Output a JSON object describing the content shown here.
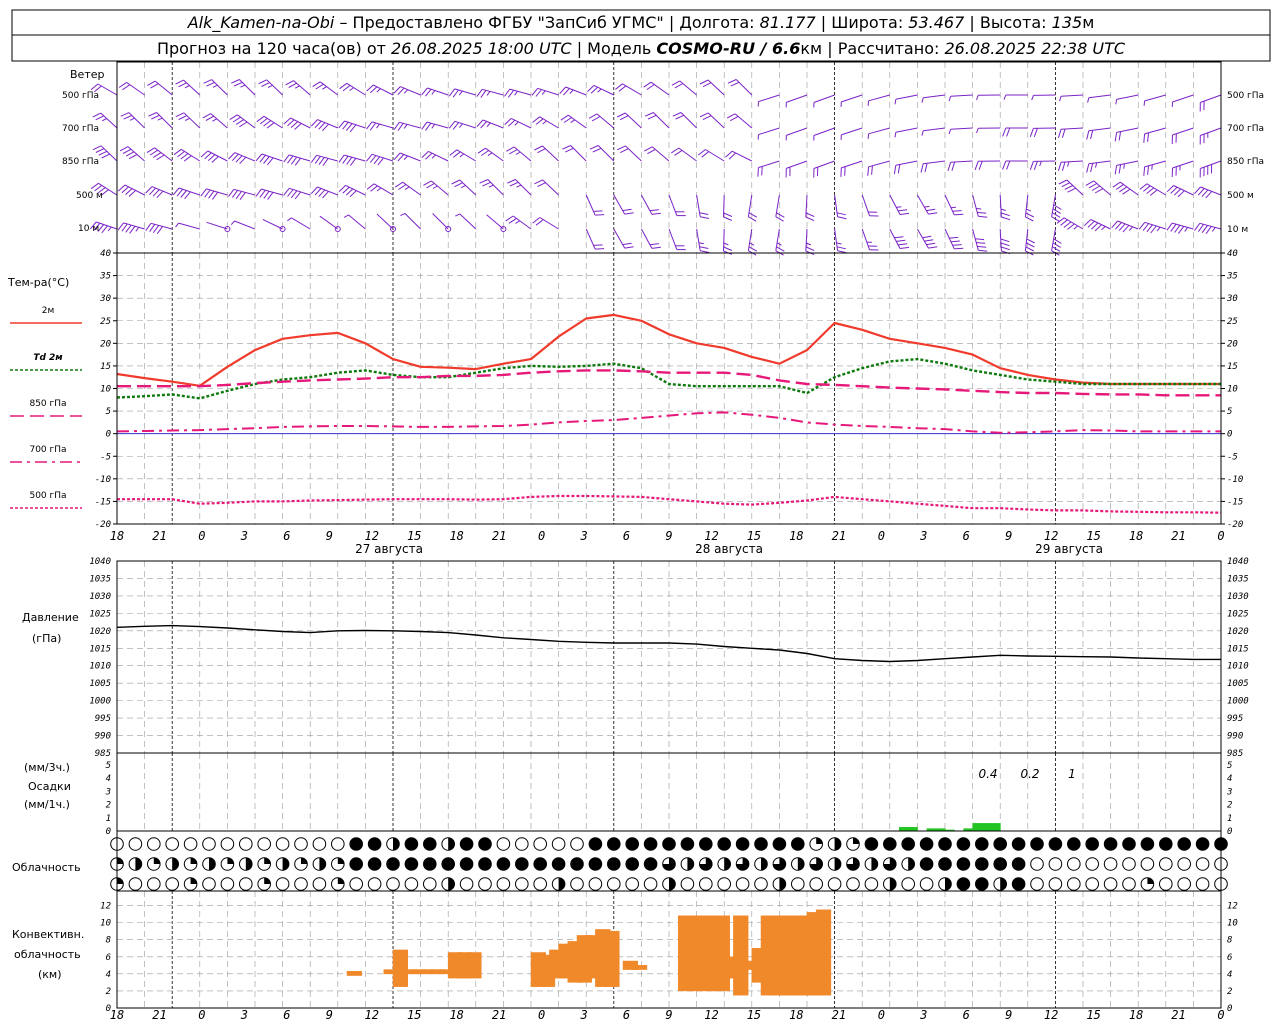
{
  "header": {
    "station": "Alk_Kamen-na-Obi",
    "dash": "–",
    "provider": "Предоставлено ФГБУ \"ЗапСиб УГМС\"",
    "lon_label": "Долгота:",
    "lon": "81.177",
    "lat_label": "Широта:",
    "lat": "53.467",
    "alt_label": "Высота:",
    "alt": "135",
    "alt_unit": "м",
    "forecast_label": "Прогноз на 120 часа(ов) от",
    "forecast_from": "26.08.2025 18:00 UTC",
    "model_label": "Модель",
    "model": "COSMO-RU / 6.6",
    "model_unit": "км",
    "calc_label": "Рассчитано:",
    "calc": "26.08.2025 22:38 UTC"
  },
  "labels": {
    "wind": "Ветер",
    "wind_levels": [
      "500 гПа",
      "700 гПа",
      "850 гПа",
      "500 м",
      "10  м"
    ],
    "temp": "Тем-ра(°С)",
    "legend": [
      "2м",
      "Td  2м",
      "850 гПа",
      "700 гПа",
      "500 гПа"
    ],
    "pressure": [
      "Давление",
      "(гПа)"
    ],
    "precip": [
      "(мм/3ч.)",
      "Осадки",
      "(мм/1ч.)"
    ],
    "cloud": "Облачность",
    "conv": [
      "Конвективн.",
      "облачность",
      "(км)"
    ]
  },
  "dates": [
    "27 августа",
    "28 августа",
    "29 августа"
  ],
  "precip_values": [
    "0.4",
    "0.2",
    "1"
  ],
  "colors": {
    "t2m": "#f03a2c",
    "td2m": "#0e7a0e",
    "magenta": "#e6187a",
    "wind": "#7b22c8",
    "precip": "#22c522",
    "conv": "#f0892a",
    "zero_line": "#3333cc"
  },
  "chart_data": [
    {
      "type": "wind-barbs",
      "title": "Ветер",
      "levels": [
        "500 гПа",
        "700 гПа",
        "850 гПа",
        "500 м",
        "10 м"
      ],
      "x_hours_from_start": [
        0,
        12,
        24,
        36,
        48,
        60,
        72,
        84,
        96,
        108,
        120
      ],
      "x_tick_labels": [
        "18",
        "21",
        "0",
        "3",
        "6",
        "9",
        "12",
        "15",
        "18",
        "21",
        "0",
        "3",
        "6",
        "9",
        "12",
        "15",
        "18",
        "21",
        "0",
        "3",
        "6",
        "9",
        "12",
        "15",
        "18",
        "21",
        "0"
      ]
    },
    {
      "type": "line",
      "title": "Тем-ра(°С)",
      "ylim": [
        -20,
        40
      ],
      "yticks": [
        -20,
        -15,
        -10,
        -5,
        0,
        5,
        10,
        15,
        20,
        25,
        30,
        35,
        40
      ],
      "x_tick_labels": [
        "18",
        "21",
        "0",
        "3",
        "6",
        "9",
        "12",
        "15",
        "18",
        "21",
        "0",
        "3",
        "6",
        "9",
        "12",
        "15",
        "18",
        "21",
        "0",
        "3",
        "6",
        "9",
        "12",
        "15",
        "18",
        "21",
        "0"
      ],
      "x_hours_from_start": [
        0,
        3,
        6,
        9,
        12,
        15,
        18,
        21,
        24,
        27,
        30,
        33,
        36,
        39,
        42,
        45,
        48,
        51,
        54,
        57,
        60,
        63,
        66,
        69,
        72,
        75,
        78,
        81,
        84,
        87,
        90,
        93,
        96,
        99,
        102,
        105,
        108,
        111,
        114,
        117,
        120
      ],
      "series": [
        {
          "name": "2м",
          "values": [
            13.2,
            12.3,
            11.5,
            10.6,
            14.8,
            18.5,
            21.0,
            21.8,
            22.3,
            20.0,
            16.5,
            14.8,
            14.6,
            14.3,
            15.5,
            16.5,
            21.5,
            25.5,
            26.3,
            25.0,
            22.0,
            20.0,
            19.0,
            17.0,
            15.5,
            18.5,
            24.5,
            23.0,
            21.0,
            20.0,
            19.0,
            17.5,
            14.5,
            13.0,
            12.0,
            11.3,
            11.0,
            11.0,
            11.0,
            11.0,
            11.0
          ]
        },
        {
          "name": "Td  2м",
          "values": [
            8.0,
            8.3,
            8.7,
            7.8,
            9.5,
            11.0,
            12.0,
            12.5,
            13.5,
            14.0,
            13.0,
            12.5,
            12.5,
            13.5,
            14.5,
            15.0,
            14.8,
            15.0,
            15.5,
            14.5,
            11.0,
            10.5,
            10.5,
            10.5,
            10.5,
            9.0,
            12.5,
            14.5,
            16.0,
            16.5,
            15.5,
            14.0,
            13.0,
            12.0,
            11.5,
            11.0,
            11.0,
            11.0,
            11.0,
            11.0,
            11.0
          ]
        },
        {
          "name": "850 гПа",
          "values": [
            10.5,
            10.5,
            10.5,
            10.5,
            10.8,
            11.2,
            11.5,
            11.8,
            12.0,
            12.2,
            12.5,
            12.5,
            12.8,
            12.8,
            13.0,
            13.5,
            13.8,
            14.0,
            14.0,
            13.8,
            13.5,
            13.5,
            13.5,
            13.0,
            11.8,
            11.0,
            10.8,
            10.5,
            10.2,
            10.0,
            9.8,
            9.5,
            9.2,
            9.0,
            9.0,
            8.8,
            8.7,
            8.7,
            8.5,
            8.5,
            8.5
          ]
        },
        {
          "name": "700 гПа",
          "values": [
            0.5,
            0.6,
            0.7,
            0.8,
            1.0,
            1.2,
            1.5,
            1.6,
            1.7,
            1.7,
            1.6,
            1.5,
            1.5,
            1.6,
            1.7,
            2.0,
            2.5,
            2.8,
            3.0,
            3.5,
            4.0,
            4.5,
            4.7,
            4.2,
            3.5,
            2.5,
            2.0,
            1.7,
            1.5,
            1.2,
            1.0,
            0.5,
            0.2,
            0.3,
            0.5,
            0.8,
            0.7,
            0.5,
            0.5,
            0.5,
            0.5
          ]
        },
        {
          "name": "500 гПа",
          "values": [
            -14.5,
            -14.5,
            -14.5,
            -15.5,
            -15.3,
            -15.0,
            -15.0,
            -14.8,
            -14.7,
            -14.6,
            -14.5,
            -14.5,
            -14.5,
            -14.6,
            -14.5,
            -14.0,
            -13.8,
            -13.8,
            -13.9,
            -14.0,
            -14.5,
            -15.0,
            -15.5,
            -15.7,
            -15.3,
            -14.8,
            -14.0,
            -14.5,
            -15.0,
            -15.5,
            -16.0,
            -16.5,
            -16.5,
            -16.8,
            -17.0,
            -17.0,
            -17.2,
            -17.3,
            -17.4,
            -17.4,
            -17.5
          ]
        }
      ]
    },
    {
      "type": "line",
      "title": "Давление (гПа)",
      "ylim": [
        985,
        1040
      ],
      "yticks": [
        985,
        990,
        995,
        1000,
        1005,
        1010,
        1015,
        1020,
        1025,
        1030,
        1035,
        1040
      ],
      "x_hours_from_start": [
        0,
        3,
        6,
        9,
        12,
        15,
        18,
        21,
        24,
        27,
        30,
        33,
        36,
        39,
        42,
        45,
        48,
        51,
        54,
        57,
        60,
        63,
        66,
        69,
        72,
        75,
        78,
        81,
        84,
        87,
        90,
        93,
        96,
        99,
        102,
        105,
        108,
        111,
        114,
        117,
        120
      ],
      "series": [
        {
          "name": "Давление",
          "values": [
            1021.0,
            1021.3,
            1021.5,
            1021.2,
            1020.8,
            1020.3,
            1019.8,
            1019.5,
            1020.0,
            1020.1,
            1020.0,
            1019.8,
            1019.5,
            1018.8,
            1018.0,
            1017.5,
            1017.0,
            1016.7,
            1016.5,
            1016.5,
            1016.5,
            1016.2,
            1015.5,
            1015.0,
            1014.5,
            1013.5,
            1012.0,
            1011.5,
            1011.2,
            1011.5,
            1012.0,
            1012.5,
            1013.0,
            1012.8,
            1012.7,
            1012.6,
            1012.5,
            1012.2,
            1012.0,
            1011.8,
            1011.8
          ]
        }
      ]
    },
    {
      "type": "bar",
      "title": "Осадки",
      "ylabel": "(мм/3ч.) (мм/1ч.)",
      "ylim": [
        0,
        5
      ],
      "yticks": [
        0,
        1,
        2,
        3,
        4,
        5
      ],
      "x_hours_from_start": [
        85,
        86,
        88,
        89,
        90,
        92,
        93,
        94,
        95
      ],
      "values": [
        0.3,
        0.3,
        0.2,
        0.2,
        0.1,
        0.2,
        0.6,
        0.6,
        0.6
      ],
      "labels": [
        "0.4",
        "0.2",
        "1"
      ]
    },
    {
      "type": "bar",
      "title": "Конвективн. облачность (км)",
      "ylim": [
        0,
        13
      ],
      "yticks": [
        0,
        2,
        4,
        6,
        8,
        10,
        12
      ],
      "x_hours_from_start": [
        25,
        29,
        30,
        31,
        32,
        33,
        34,
        35,
        36,
        37,
        38,
        45,
        46,
        47,
        48,
        49,
        50,
        51,
        52,
        53,
        55,
        56,
        61,
        62,
        63,
        64,
        65,
        66,
        67,
        68,
        69,
        70,
        71,
        72,
        73,
        74,
        75,
        76
      ],
      "series": [
        {
          "name": "base",
          "values": [
            3.8,
            4.0,
            2.5,
            4.0,
            4.0,
            4.0,
            4.0,
            4.0,
            3.5,
            3.5,
            3.5,
            2.5,
            2.5,
            3.5,
            3.5,
            3.0,
            3.0,
            3.5,
            2.5,
            2.5,
            4.5,
            4.5,
            2.0,
            2.0,
            2.0,
            2.0,
            2.0,
            3.5,
            1.5,
            4.5,
            3.0,
            1.5,
            1.5,
            1.5,
            1.5,
            1.5,
            1.5,
            1.5
          ]
        },
        {
          "name": "top",
          "values": [
            4.3,
            4.5,
            6.8,
            4.5,
            4.5,
            4.5,
            4.5,
            4.5,
            6.5,
            6.5,
            6.5,
            6.5,
            6.2,
            6.8,
            7.5,
            7.8,
            8.5,
            8.5,
            9.2,
            9.0,
            5.5,
            5.0,
            10.8,
            10.8,
            10.8,
            10.8,
            10.8,
            6.0,
            10.8,
            5.5,
            7.0,
            10.8,
            10.8,
            10.8,
            10.8,
            10.8,
            11.2,
            11.5
          ]
        }
      ]
    }
  ]
}
